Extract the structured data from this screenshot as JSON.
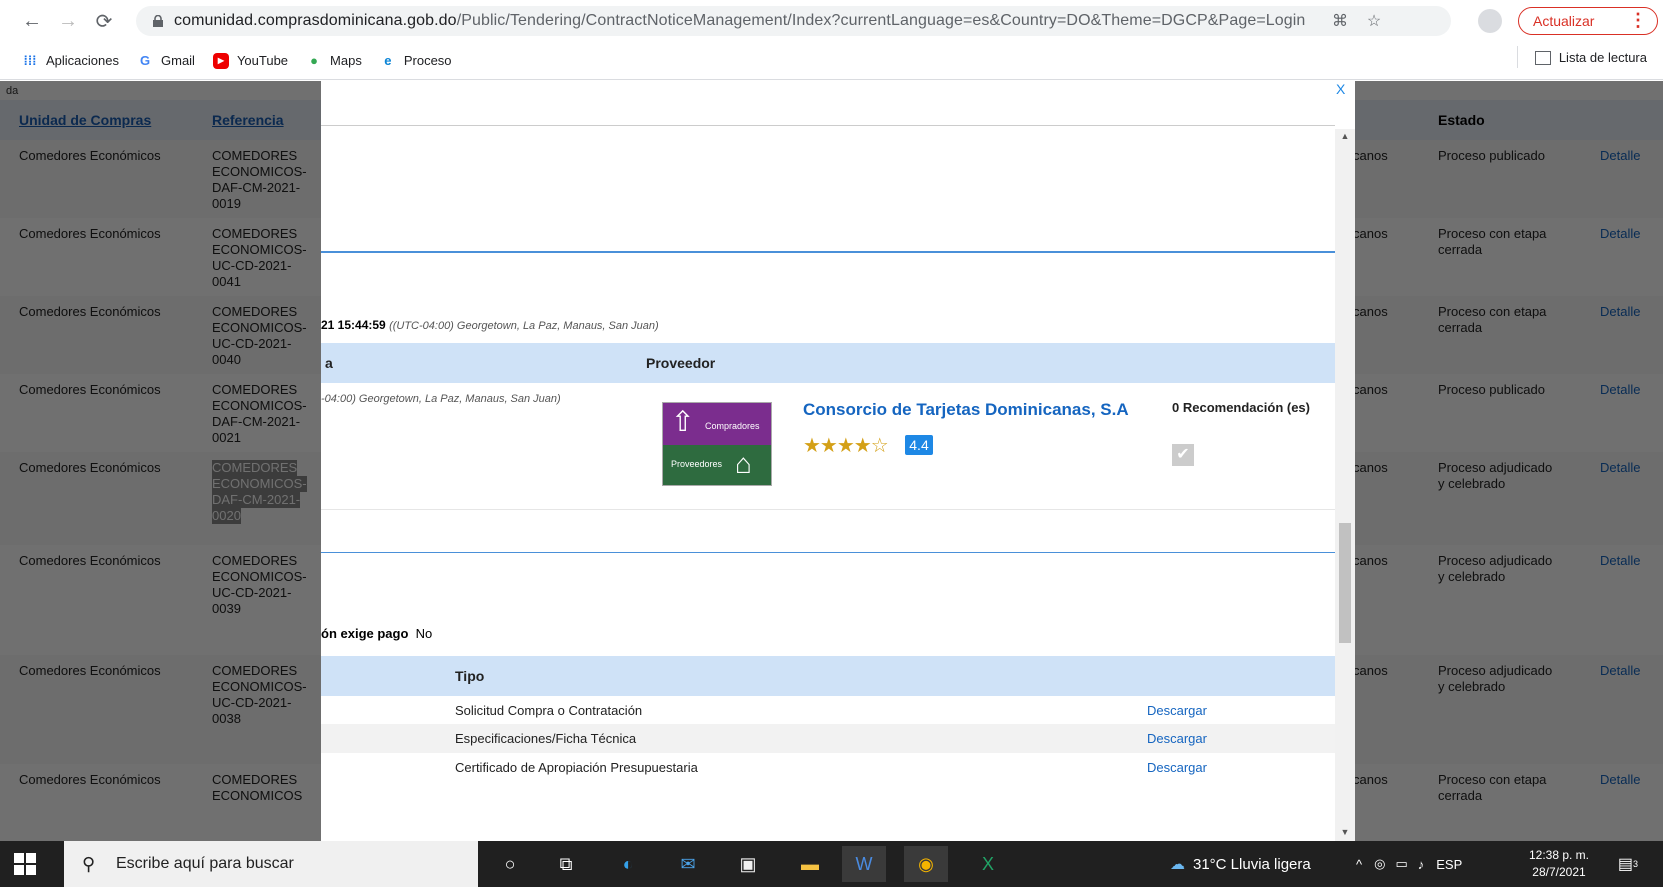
{
  "browser": {
    "url_host": "comunidad.comprasdominicana.gob.do",
    "url_path": "/Public/Tendering/ContractNoticeManagement/Index?currentLanguage=es&Country=DO&Theme=DGCP&Page=Login",
    "update_label": "Actualizar",
    "bookmarks": [
      "Aplicaciones",
      "Gmail",
      "YouTube",
      "Maps",
      "Proceso"
    ],
    "reading_list": "Lista de lectura"
  },
  "background": {
    "partial_label": "da",
    "headers": {
      "unidad": "Unidad de Compras",
      "referencia": "Referencia",
      "estado": "Estado"
    },
    "rows": [
      {
        "unidad": "Comedores Económicos",
        "ref": [
          "COMEDORES",
          "ECONOMICOS-",
          "DAF-CM-2021-",
          "0019"
        ],
        "col": "inicanos",
        "estado": [
          "Proceso publicado"
        ],
        "detalle": "Detalle"
      },
      {
        "unidad": "Comedores Económicos",
        "ref": [
          "COMEDORES",
          "ECONOMICOS-",
          "UC-CD-2021-",
          "0041"
        ],
        "col": "inicanos",
        "estado": [
          "Proceso con etapa",
          "cerrada"
        ],
        "detalle": "Detalle"
      },
      {
        "unidad": "Comedores Económicos",
        "ref": [
          "COMEDORES",
          "ECONOMICOS-",
          "UC-CD-2021-",
          "0040"
        ],
        "col": "inicanos",
        "estado": [
          "Proceso con etapa",
          "cerrada"
        ],
        "detalle": "Detalle"
      },
      {
        "unidad": "Comedores Económicos",
        "ref": [
          "COMEDORES",
          "ECONOMICOS-",
          "DAF-CM-2021-",
          "0021"
        ],
        "col": "inicanos",
        "estado": [
          "Proceso publicado"
        ],
        "detalle": "Detalle"
      },
      {
        "unidad": "Comedores Económicos",
        "ref": [
          "COMEDORES",
          "ECONOMICOS-",
          "DAF-CM-2021-",
          "0020"
        ],
        "col": "inicanos",
        "estado": [
          "Proceso adjudicado",
          "y celebrado"
        ],
        "detalle": "Detalle"
      },
      {
        "unidad": "Comedores Económicos",
        "ref": [
          "COMEDORES",
          "ECONOMICOS-",
          "UC-CD-2021-",
          "0039"
        ],
        "col": "inicanos",
        "estado": [
          "Proceso adjudicado",
          "y celebrado"
        ],
        "detalle": "Detalle"
      },
      {
        "unidad": "Comedores Económicos",
        "ref": [
          "COMEDORES",
          "ECONOMICOS-",
          "UC-CD-2021-",
          "0038"
        ],
        "col": "inicanos",
        "estado": [
          "Proceso adjudicado",
          "y celebrado"
        ],
        "detalle": "Detalle"
      },
      {
        "unidad": "Comedores Económicos",
        "ref": [
          "COMEDORES",
          "ECONOMICOS"
        ],
        "col": "inicanos",
        "estado": [
          "Proceso con etapa",
          "cerrada"
        ],
        "detalle": "Detalle"
      }
    ]
  },
  "modal": {
    "close": "X",
    "date_text": "21 15:44:59",
    "timezone": "((UTC-04:00) Georgetown, La Paz, Manaus, San Juan)",
    "band1_left": "a",
    "band1_right": "Proveedor",
    "row_timezone": "-04:00) Georgetown, La Paz, Manaus, San Juan)",
    "logo_top": "Compradores",
    "logo_bottom": "Proveedores",
    "supplier": "Consorcio de Tarjetas Dominicanas, S.A",
    "rating": "4.4",
    "recomendaciones": "0 Recomendación (es)",
    "pago_label": "ón exige pago",
    "pago_value": "No",
    "tipo_header": "Tipo",
    "documents": [
      {
        "tipo": "Solicitud Compra o Contratación",
        "action": "Descargar"
      },
      {
        "tipo": "Especificaciones/Ficha Técnica",
        "action": "Descargar"
      },
      {
        "tipo": "Certificado de Apropiación Presupuestaria",
        "action": "Descargar"
      }
    ]
  },
  "taskbar": {
    "search_placeholder": "Escribe aquí para buscar",
    "weather": "31°C  Lluvia ligera",
    "lang": "ESP",
    "time": "12:38 p. m.",
    "date": "28/7/2021",
    "notifications": "3"
  }
}
